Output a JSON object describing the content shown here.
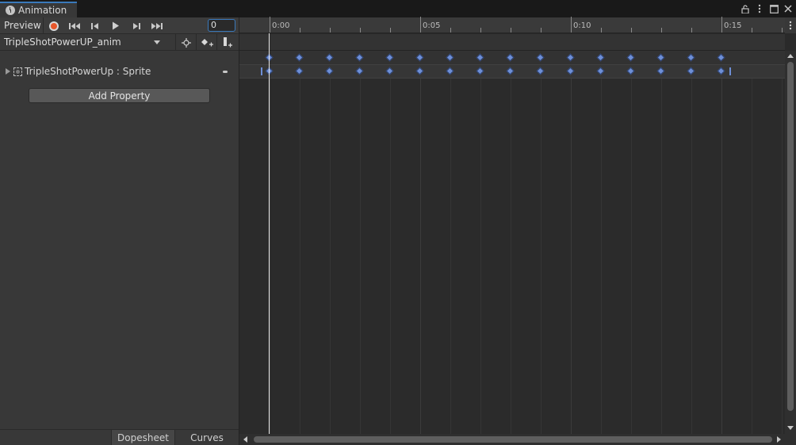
{
  "window": {
    "tab_label": "Animation",
    "tab_icon": "clock-icon"
  },
  "toolbar": {
    "preview_label": "Preview",
    "record_icon": "record-icon",
    "first_key_icon": "go-to-beginning-icon",
    "prev_key_icon": "previous-frame-icon",
    "play_icon": "play-icon",
    "next_key_icon": "next-frame-icon",
    "last_key_icon": "go-to-end-icon",
    "frame_value": "0"
  },
  "clip": {
    "selected_clip": "TripleShotPowerUP_anim"
  },
  "tools": {
    "filter_icon": "filter-by-selection-icon",
    "add_keyframe_icon": "add-keyframe-icon",
    "add_event_icon": "add-event-icon"
  },
  "hierarchy": {
    "properties": [
      {
        "label": "TripleShotPowerUp : Sprite"
      }
    ],
    "add_property_label": "Add Property"
  },
  "view_tabs": {
    "dopesheet_label": "Dopesheet",
    "curves_label": "Curves",
    "active": "Dopesheet"
  },
  "timeline": {
    "ruler_labels": [
      "0:00",
      "0:05",
      "0:10",
      "0:15"
    ],
    "current_frame": 0,
    "keyframe_frames": [
      0,
      1,
      2,
      3,
      4,
      5,
      6,
      7,
      8,
      9,
      10,
      11,
      12,
      13,
      14,
      15
    ],
    "colors": {
      "keyframe": "#6e8fd6",
      "playhead": "#e8e8e8"
    }
  }
}
